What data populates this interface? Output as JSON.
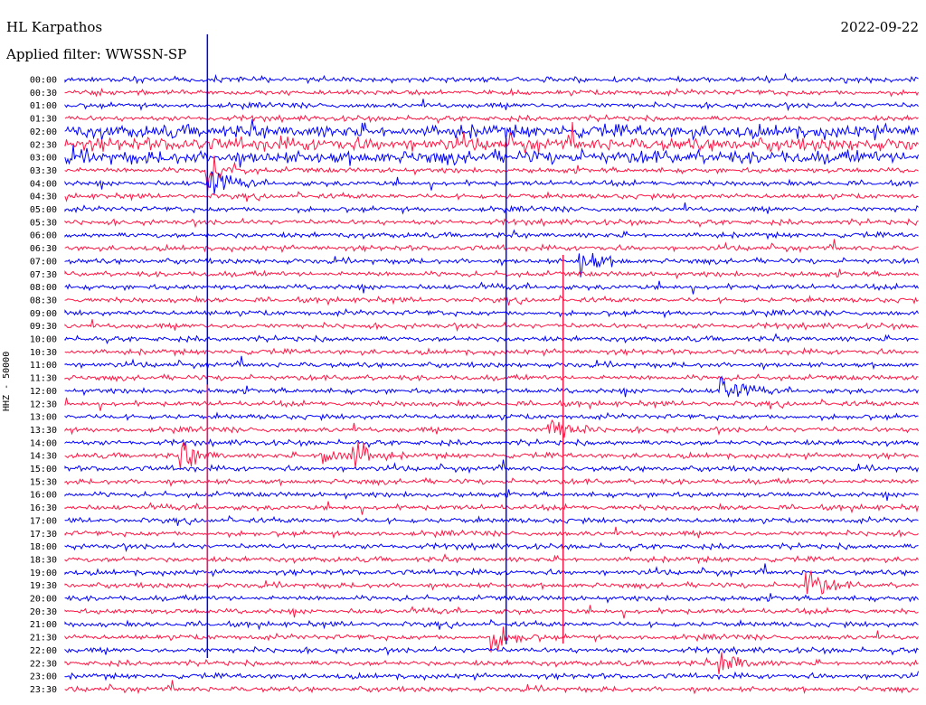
{
  "header": {
    "station": "HL Karpathos",
    "filter": "Applied filter: WWSSN-SP",
    "date": "2022-09-22"
  },
  "chart_data": {
    "type": "line",
    "title": "HL Karpathos",
    "subtitle": "Applied filter: WWSSN-SP",
    "date": "2022-09-22",
    "ylabel": "HHZ - 50000",
    "row_labels": [
      "00:00",
      "00:30",
      "01:00",
      "01:30",
      "02:00",
      "02:30",
      "03:00",
      "03:30",
      "04:00",
      "04:30",
      "05:00",
      "05:30",
      "06:00",
      "06:30",
      "07:00",
      "07:30",
      "08:00",
      "08:30",
      "09:00",
      "09:30",
      "10:00",
      "10:30",
      "11:00",
      "11:30",
      "12:00",
      "12:30",
      "13:00",
      "13:30",
      "14:00",
      "14:30",
      "15:00",
      "15:30",
      "16:00",
      "16:30",
      "17:00",
      "17:30",
      "18:00",
      "18:30",
      "19:00",
      "19:30",
      "20:00",
      "20:30",
      "21:00",
      "21:30",
      "22:00",
      "22:30",
      "23:00",
      "23:30"
    ],
    "colors": [
      "#0000ff",
      "#ff1745"
    ],
    "trace_minutes": 30,
    "events": [
      {
        "row": "03:30",
        "minute": 5
      },
      {
        "row": "04:00",
        "minute": 5
      },
      {
        "row": "14:30",
        "minute": 4
      },
      {
        "row": "14:30",
        "minute": 9
      },
      {
        "row": "14:30",
        "minute": 10
      },
      {
        "row": "07:00",
        "minute": 18
      },
      {
        "row": "13:30",
        "minute": 17
      },
      {
        "row": "21:30",
        "minute": 15
      },
      {
        "row": "12:00",
        "minute": 23
      },
      {
        "row": "19:30",
        "minute": 26
      },
      {
        "row": "22:30",
        "minute": 23
      }
    ]
  }
}
